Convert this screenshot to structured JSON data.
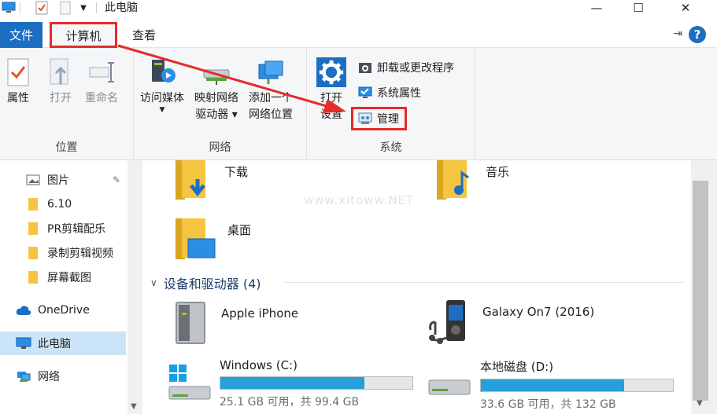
{
  "window": {
    "title": "此电脑",
    "minimize": "—",
    "maximize": "☐",
    "close": "✕"
  },
  "tabs": {
    "file": "文件",
    "computer": "计算机",
    "view": "查看"
  },
  "ribbon": {
    "location": {
      "label": "位置",
      "properties": "属性",
      "open": "打开",
      "rename": "重命名"
    },
    "network": {
      "label": "网络",
      "access_media": "访问媒体",
      "map_drive_1": "映射网络",
      "map_drive_2": "驱动器 ▾",
      "add_location_1": "添加一个",
      "add_location_2": "网络位置"
    },
    "system": {
      "label": "系统",
      "open_settings_1": "打开",
      "open_settings_2": "设置",
      "uninstall": "卸载或更改程序",
      "system_properties": "系统属性",
      "manage": "管理"
    }
  },
  "nav": {
    "items": [
      {
        "label": "图片"
      },
      {
        "label": "6.10"
      },
      {
        "label": "PR剪辑配乐"
      },
      {
        "label": "录制剪辑视频"
      },
      {
        "label": "屏幕截图"
      },
      {
        "label": "OneDrive"
      },
      {
        "label": "此电脑"
      },
      {
        "label": "网络"
      }
    ]
  },
  "content": {
    "folders": [
      {
        "label": "下载"
      },
      {
        "label": "音乐"
      },
      {
        "label": "桌面"
      }
    ],
    "devices_header": "设备和驱动器 (4)",
    "devices": [
      {
        "label": "Apple iPhone"
      },
      {
        "label": "Galaxy On7 (2016)"
      }
    ],
    "drives": [
      {
        "label": "Windows (C:)",
        "free_text": "25.1 GB 可用，共 99.4 GB",
        "used_fraction": 0.75
      },
      {
        "label": "本地磁盘 (D:)",
        "free_text": "33.6 GB 可用，共 132 GB",
        "used_fraction": 0.745
      }
    ],
    "watermark": "www.xitoww.NET"
  },
  "colors": {
    "accent": "#1b6ec2",
    "highlight_red": "#e52b2b",
    "drive_bar": "#26a0da",
    "selected_nav": "#cce4f7"
  }
}
